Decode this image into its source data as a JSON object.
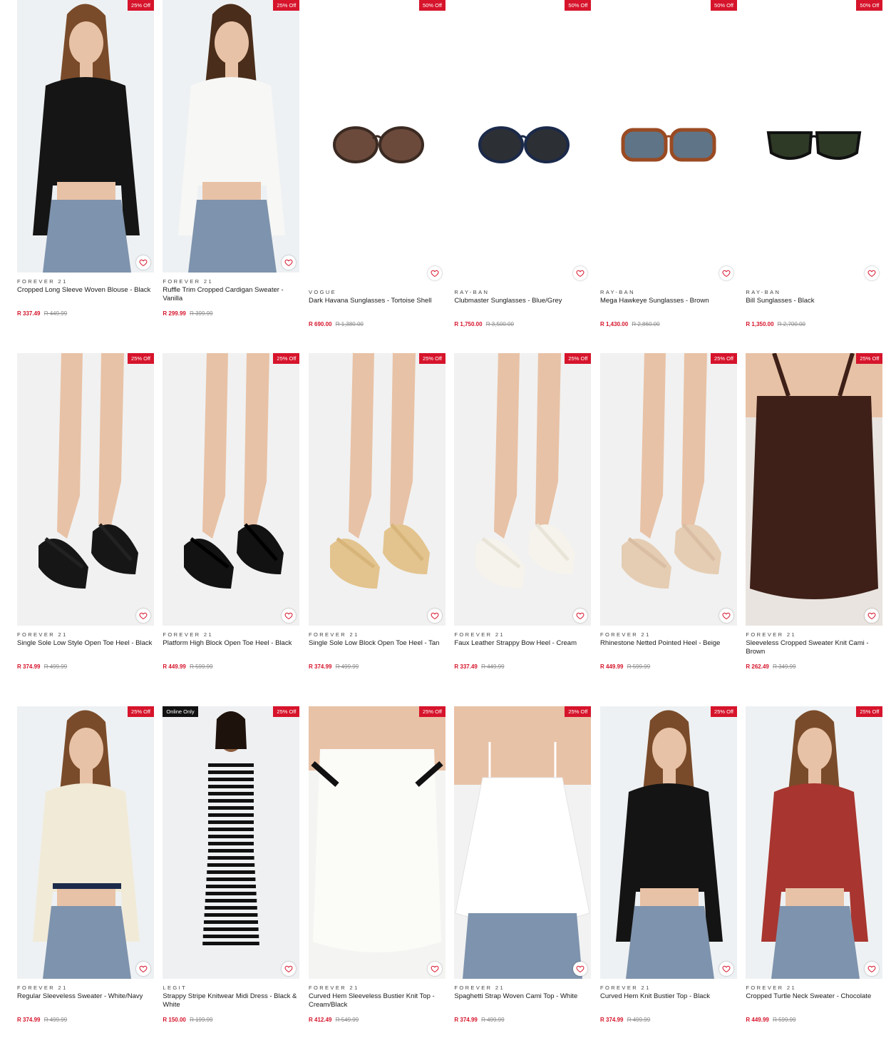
{
  "colors": {
    "accent": "#d6142b",
    "badge_dark": "#111111"
  },
  "rows": [
    {
      "products": [
        {
          "brand": "FOREVER 21",
          "name": "Cropped Long Sleeve Woven Blouse - Black",
          "price": "R 337.49",
          "was_price": "R 449.99",
          "discount": "25% Off",
          "image": "model-black-top",
          "icon": "heart-icon"
        },
        {
          "brand": "FOREVER 21",
          "name": "Ruffle Trim Cropped Cardigan Sweater - Vanilla",
          "price": "R 299.99",
          "was_price": "R 399.99",
          "discount": "25% Off",
          "image": "model-white-cardigan",
          "icon": "heart-icon"
        },
        {
          "brand": "VOGUE",
          "name": "Dark Havana Sunglasses - Tortoise Shell",
          "price": "R 690.00",
          "was_price": "R 1,380.00",
          "discount": "50% Off",
          "image": "sunglasses-round-brown",
          "icon": "heart-icon"
        },
        {
          "brand": "RAY-BAN",
          "name": "Clubmaster Sunglasses - Blue/Grey",
          "price": "R 1,750.00",
          "was_price": "R 3,500.00",
          "discount": "50% Off",
          "image": "sunglasses-clubmaster",
          "icon": "heart-icon"
        },
        {
          "brand": "RAY-BAN",
          "name": "Mega Hawkeye Sunglasses - Brown",
          "price": "R 1,430.00",
          "was_price": "R 2,860.00",
          "discount": "50% Off",
          "image": "sunglasses-tortoise-blue",
          "icon": "heart-icon"
        },
        {
          "brand": "RAY-BAN",
          "name": "Bill Sunglasses - Black",
          "price": "R 1,350.00",
          "was_price": "R 2,700.00",
          "discount": "50% Off",
          "image": "sunglasses-aviator-green",
          "icon": "heart-icon"
        }
      ]
    },
    {
      "products": [
        {
          "brand": "FOREVER 21",
          "name": "Single Sole Low Style Open Toe Heel - Black",
          "price": "R 374.99",
          "was_price": "R 499.99",
          "discount": "25% Off",
          "image": "heel-black-strappy",
          "icon": "heart-icon"
        },
        {
          "brand": "FOREVER 21",
          "name": "Platform High Block Open Toe Heel - Black",
          "price": "R 449.99",
          "was_price": "R 599.99",
          "discount": "25% Off",
          "image": "heel-black-platform",
          "icon": "heart-icon"
        },
        {
          "brand": "FOREVER 21",
          "name": "Single Sole Low Block Open Toe Heel - Tan",
          "price": "R 374.99",
          "was_price": "R 499.99",
          "discount": "25% Off",
          "image": "heel-tan-raffia",
          "icon": "heart-icon"
        },
        {
          "brand": "FOREVER 21",
          "name": "Faux Leather Strappy Bow Heel - Cream",
          "price": "R 337.49",
          "was_price": "R 449.99",
          "discount": "25% Off",
          "image": "heel-cream-bow",
          "icon": "heart-icon"
        },
        {
          "brand": "FOREVER 21",
          "name": "Rhinestone Netted Pointed Heel - Beige",
          "price": "R 449.99",
          "was_price": "R 599.99",
          "discount": "25% Off",
          "image": "heel-beige-mule",
          "icon": "heart-icon"
        },
        {
          "brand": "FOREVER 21",
          "name": "Sleeveless Cropped Sweater Knit Cami - Brown",
          "price": "R 262.49",
          "was_price": "R 349.99",
          "discount": "25% Off",
          "image": "knit-cami-brown",
          "icon": "heart-icon"
        }
      ]
    },
    {
      "products": [
        {
          "brand": "FOREVER 21",
          "name": "Regular Sleeveless Sweater - White/Navy",
          "price": "R 374.99",
          "was_price": "R 499.99",
          "discount": "25% Off",
          "image": "model-sweater-vest",
          "icon": "heart-icon"
        },
        {
          "brand": "LEGIT",
          "name": "Strappy Stripe Knitwear Midi Dress - Black & White",
          "price": "R 150.00",
          "was_price": "R 199.99",
          "discount": "25% Off",
          "tag": "Online Only",
          "image": "model-stripe-dress",
          "icon": "heart-icon"
        },
        {
          "brand": "FOREVER 21",
          "name": "Curved Hem Sleeveless Bustier Knit Top - Cream/Black",
          "price": "R 412.49",
          "was_price": "R 549.99",
          "discount": "25% Off",
          "image": "bustier-cream",
          "icon": "heart-icon"
        },
        {
          "brand": "FOREVER 21",
          "name": "Spaghetti Strap Woven Cami Top - White",
          "price": "R 374.99",
          "was_price": "R 499.99",
          "discount": "25% Off",
          "image": "cami-white",
          "icon": "heart-icon"
        },
        {
          "brand": "FOREVER 21",
          "name": "Curved Hem Knit Bustier Top - Black",
          "price": "R 374.99",
          "was_price": "R 499.99",
          "discount": "25% Off",
          "image": "model-bustier-black",
          "icon": "heart-icon"
        },
        {
          "brand": "FOREVER 21",
          "name": "Cropped Turtle Neck Sweater - Chocolate",
          "price": "R 449.99",
          "was_price": "R 599.99",
          "discount": "25% Off",
          "image": "model-turtleneck-red",
          "icon": "heart-icon"
        }
      ]
    }
  ]
}
